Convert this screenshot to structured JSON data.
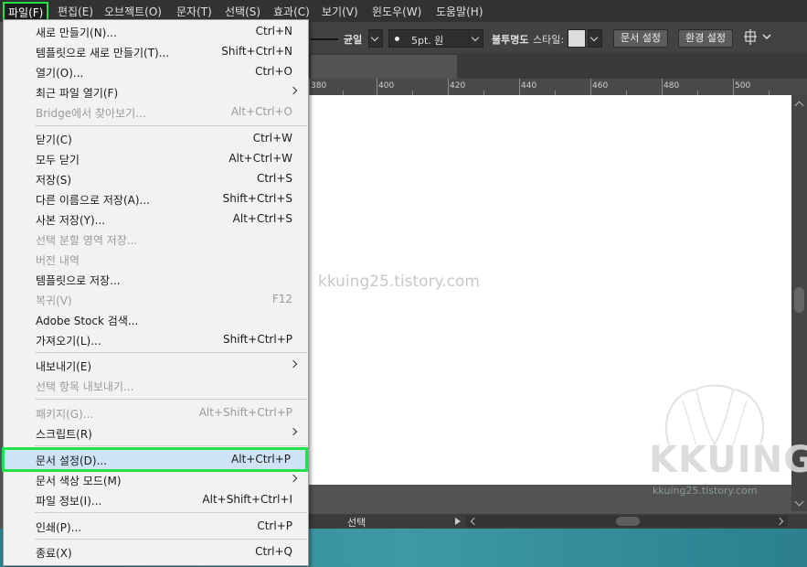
{
  "menubar": {
    "items": [
      "파일(F)",
      "편집(E)",
      "오브젝트(O)",
      "문자(T)",
      "선택(S)",
      "효과(C)",
      "보기(V)",
      "윈도우(W)",
      "도움말(H)"
    ]
  },
  "toolbar": {
    "stroke_profile": "균일",
    "brush_size": "5pt. 원",
    "opacity_label": "불투명도",
    "style_label": "스타일:",
    "doc_setup_button": "문서 설정",
    "preferences_button": "환경 설정"
  },
  "ruler": {
    "labels": [
      "380",
      "400",
      "420",
      "440",
      "460",
      "480",
      "500"
    ]
  },
  "status": {
    "tool": "선택"
  },
  "watermark": {
    "url": "kkuing25.tistory.com",
    "logo": "KKUING",
    "logo_sub": "kkuing25.tistory.com"
  },
  "file_menu": {
    "items": [
      {
        "label": "새로 만들기(N)...",
        "shortcut": "Ctrl+N"
      },
      {
        "label": "템플릿으로 새로 만들기(T)...",
        "shortcut": "Shift+Ctrl+N"
      },
      {
        "label": "열기(O)...",
        "shortcut": "Ctrl+O"
      },
      {
        "label": "최근 파일 열기(F)",
        "shortcut": ""
      },
      {
        "label": "Bridge에서 찾아보기...",
        "shortcut": "Alt+Ctrl+O"
      },
      {
        "label": "닫기(C)",
        "shortcut": "Ctrl+W"
      },
      {
        "label": "모두 닫기",
        "shortcut": "Alt+Ctrl+W"
      },
      {
        "label": "저장(S)",
        "shortcut": "Ctrl+S"
      },
      {
        "label": "다른 이름으로 저장(A)...",
        "shortcut": "Shift+Ctrl+S"
      },
      {
        "label": "사본 저장(Y)...",
        "shortcut": "Alt+Ctrl+S"
      },
      {
        "label": "선택 분할 영역 저장...",
        "shortcut": ""
      },
      {
        "label": "버전 내역",
        "shortcut": ""
      },
      {
        "label": "템플릿으로 저장...",
        "shortcut": ""
      },
      {
        "label": "복귀(V)",
        "shortcut": "F12"
      },
      {
        "label": "Adobe Stock 검색...",
        "shortcut": ""
      },
      {
        "label": "가져오기(L)...",
        "shortcut": "Shift+Ctrl+P"
      },
      {
        "label": "내보내기(E)",
        "shortcut": ""
      },
      {
        "label": "선택 항목 내보내기...",
        "shortcut": ""
      },
      {
        "label": "패키지(G)...",
        "shortcut": "Alt+Shift+Ctrl+P"
      },
      {
        "label": "스크립트(R)",
        "shortcut": ""
      },
      {
        "label": "문서 설정(D)...",
        "shortcut": "Alt+Ctrl+P"
      },
      {
        "label": "문서 색상 모드(M)",
        "shortcut": ""
      },
      {
        "label": "파일 정보(I)...",
        "shortcut": "Alt+Shift+Ctrl+I"
      },
      {
        "label": "인쇄(P)...",
        "shortcut": "Ctrl+P"
      },
      {
        "label": "종료(X)",
        "shortcut": "Ctrl+Q"
      }
    ]
  }
}
